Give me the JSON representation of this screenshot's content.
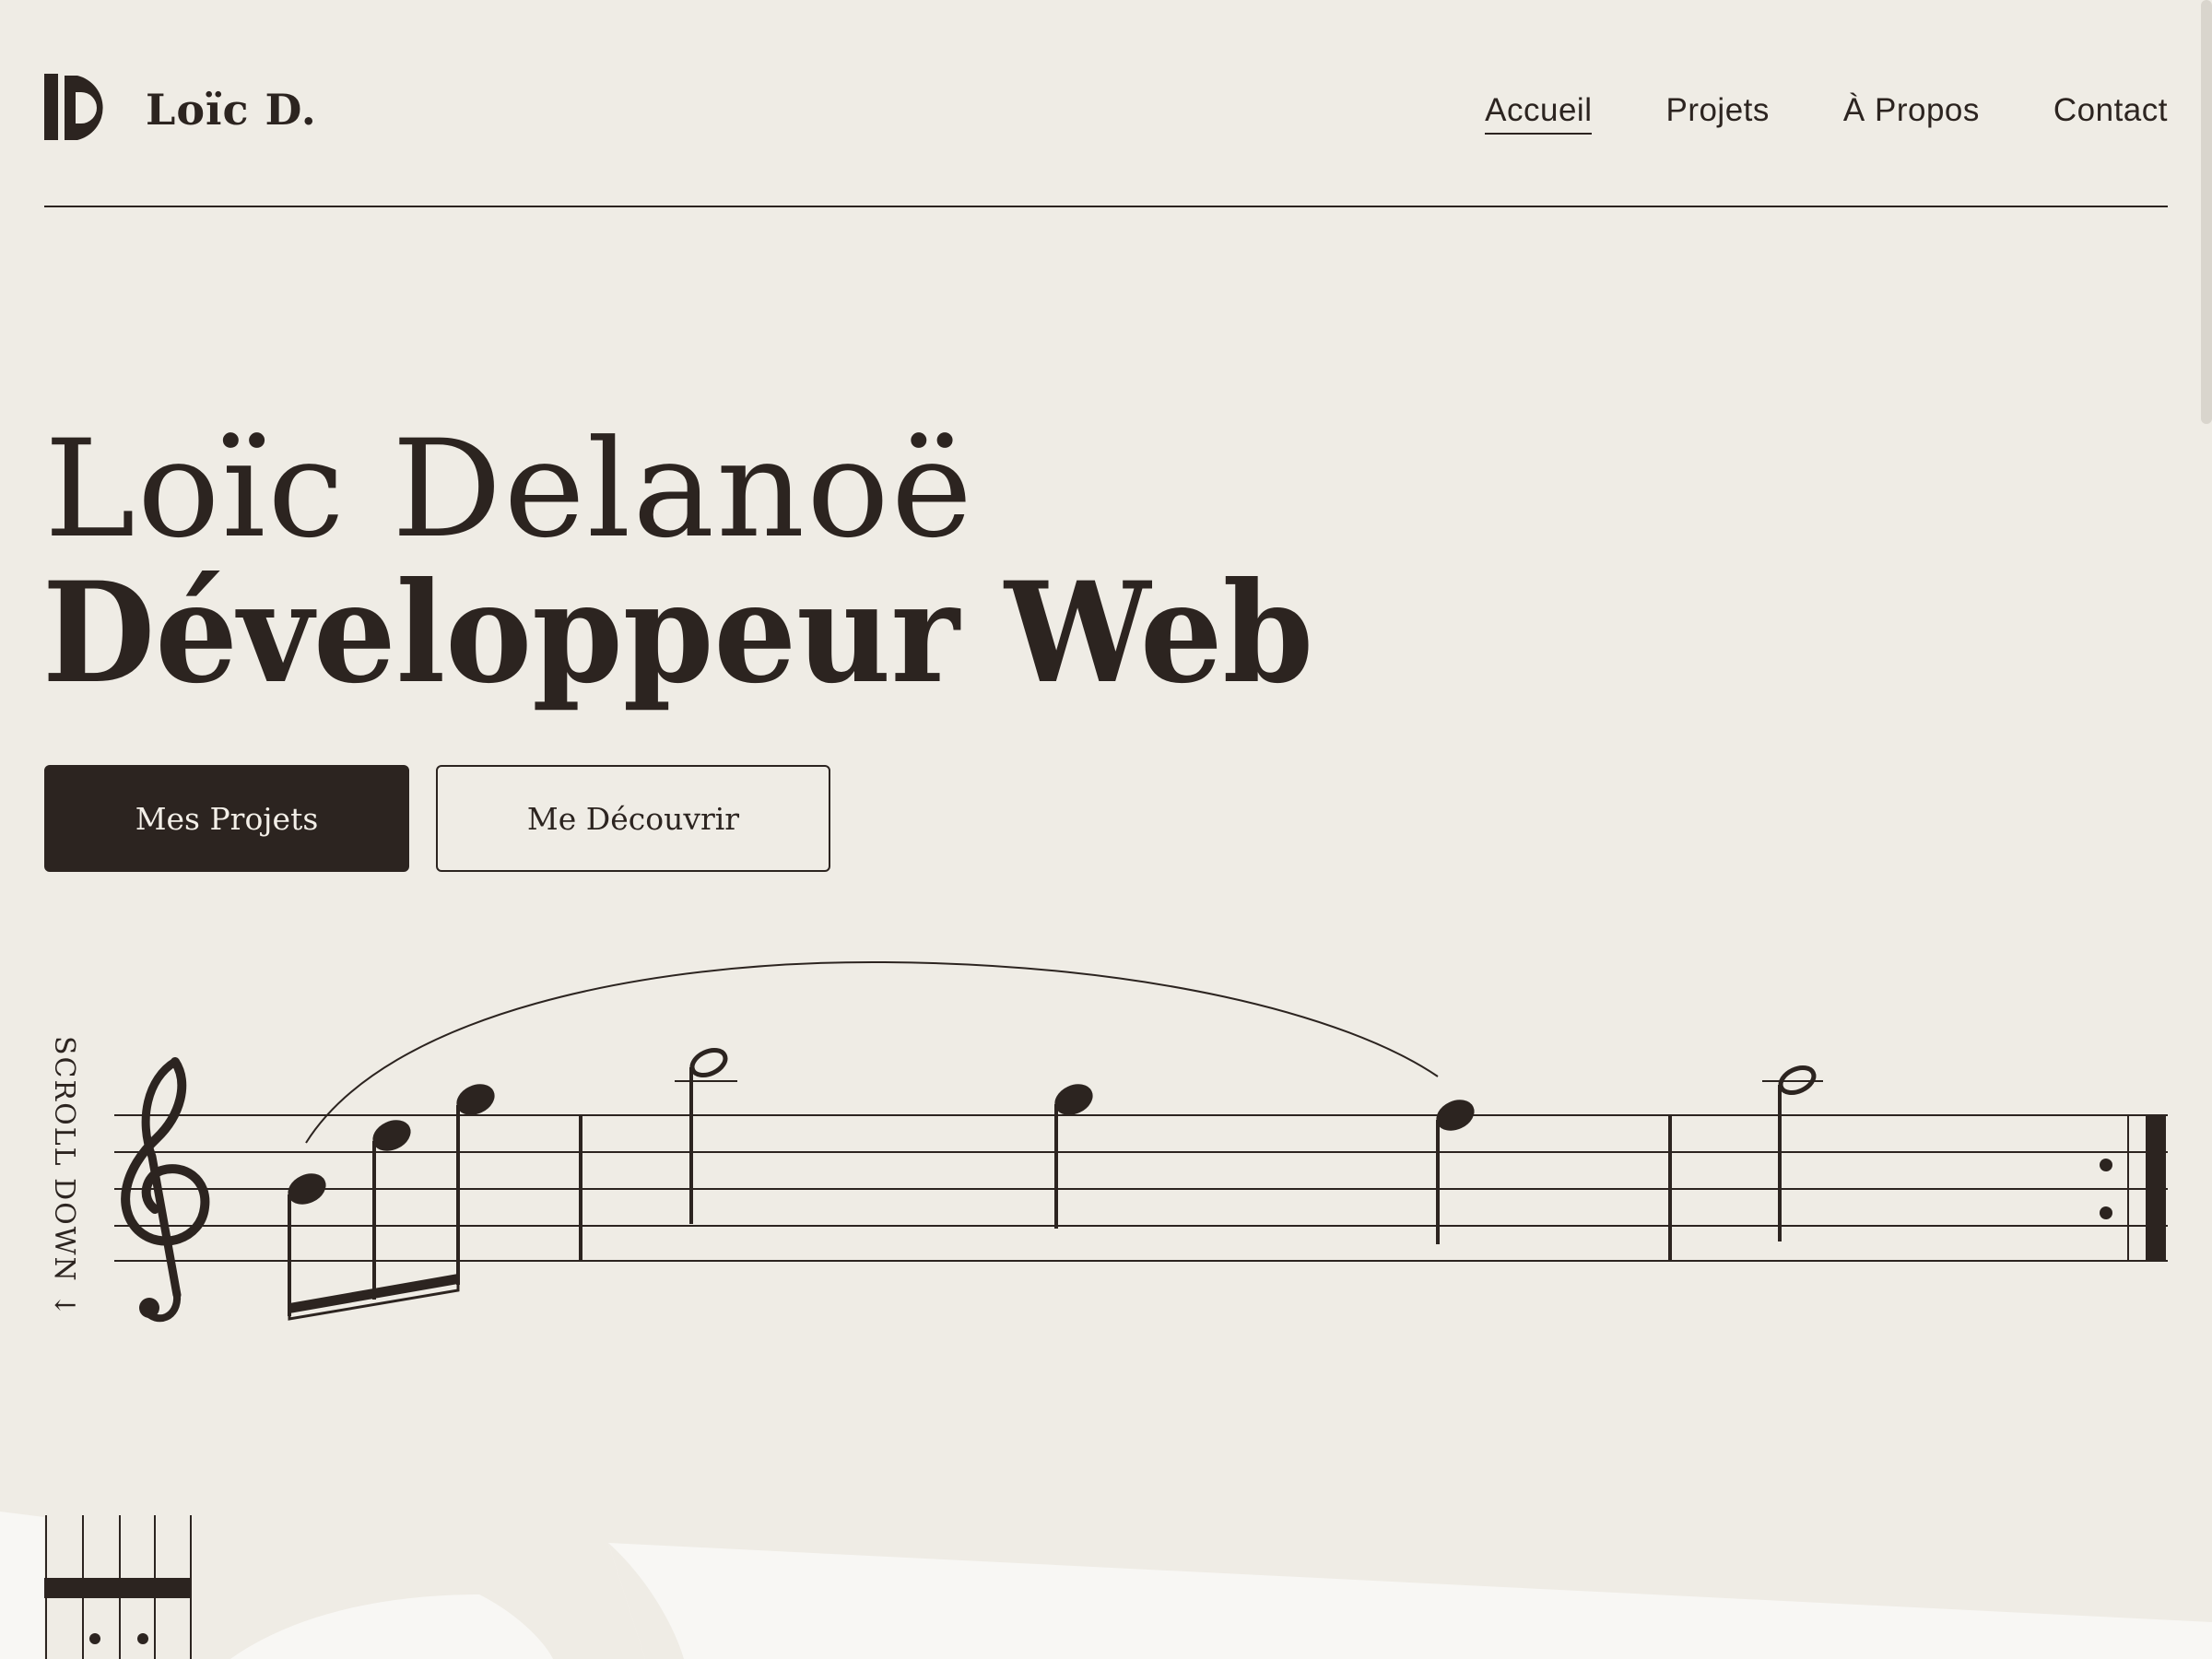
{
  "brand": {
    "logo_icon": "ld-monogram-icon",
    "name": "Loïc D."
  },
  "nav": {
    "items": [
      {
        "label": "Accueil",
        "active": true
      },
      {
        "label": "Projets",
        "active": false
      },
      {
        "label": "À Propos",
        "active": false
      },
      {
        "label": "Contact",
        "active": false
      }
    ]
  },
  "hero": {
    "name": "Loïc Delanoë",
    "role": "Développeur Web",
    "primary_button": "Mes Projets",
    "secondary_button": "Me Découvrir"
  },
  "scroll_hint": "SCROLL DOWN ↓",
  "colors": {
    "background": "#efece5",
    "ink": "#2c2420",
    "light_panel": "#f8f7f4"
  }
}
